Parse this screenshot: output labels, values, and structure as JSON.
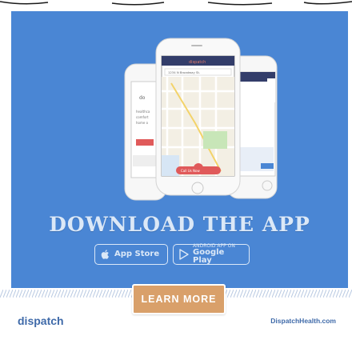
{
  "colors": {
    "background": "#4a86d4",
    "accent": "#d9a06a",
    "brand": "#3f6aa9",
    "text_light": "#dbe8f7"
  },
  "headline": "DOWNLOAD THE APP",
  "app_store": {
    "small": "",
    "big": "App Store",
    "icon": "apple-icon"
  },
  "google_play": {
    "small": "ANDROID APP ON",
    "big": "Google Play",
    "icon": "google-play-icon"
  },
  "phone_screen": {
    "app_title": "dispatch",
    "address": "1234 N Broadway St.",
    "map_button": "Call Us Now"
  },
  "footer": {
    "brand": "dispatch",
    "cta": "LEARN MORE",
    "url": "DispatchHealth.com"
  }
}
